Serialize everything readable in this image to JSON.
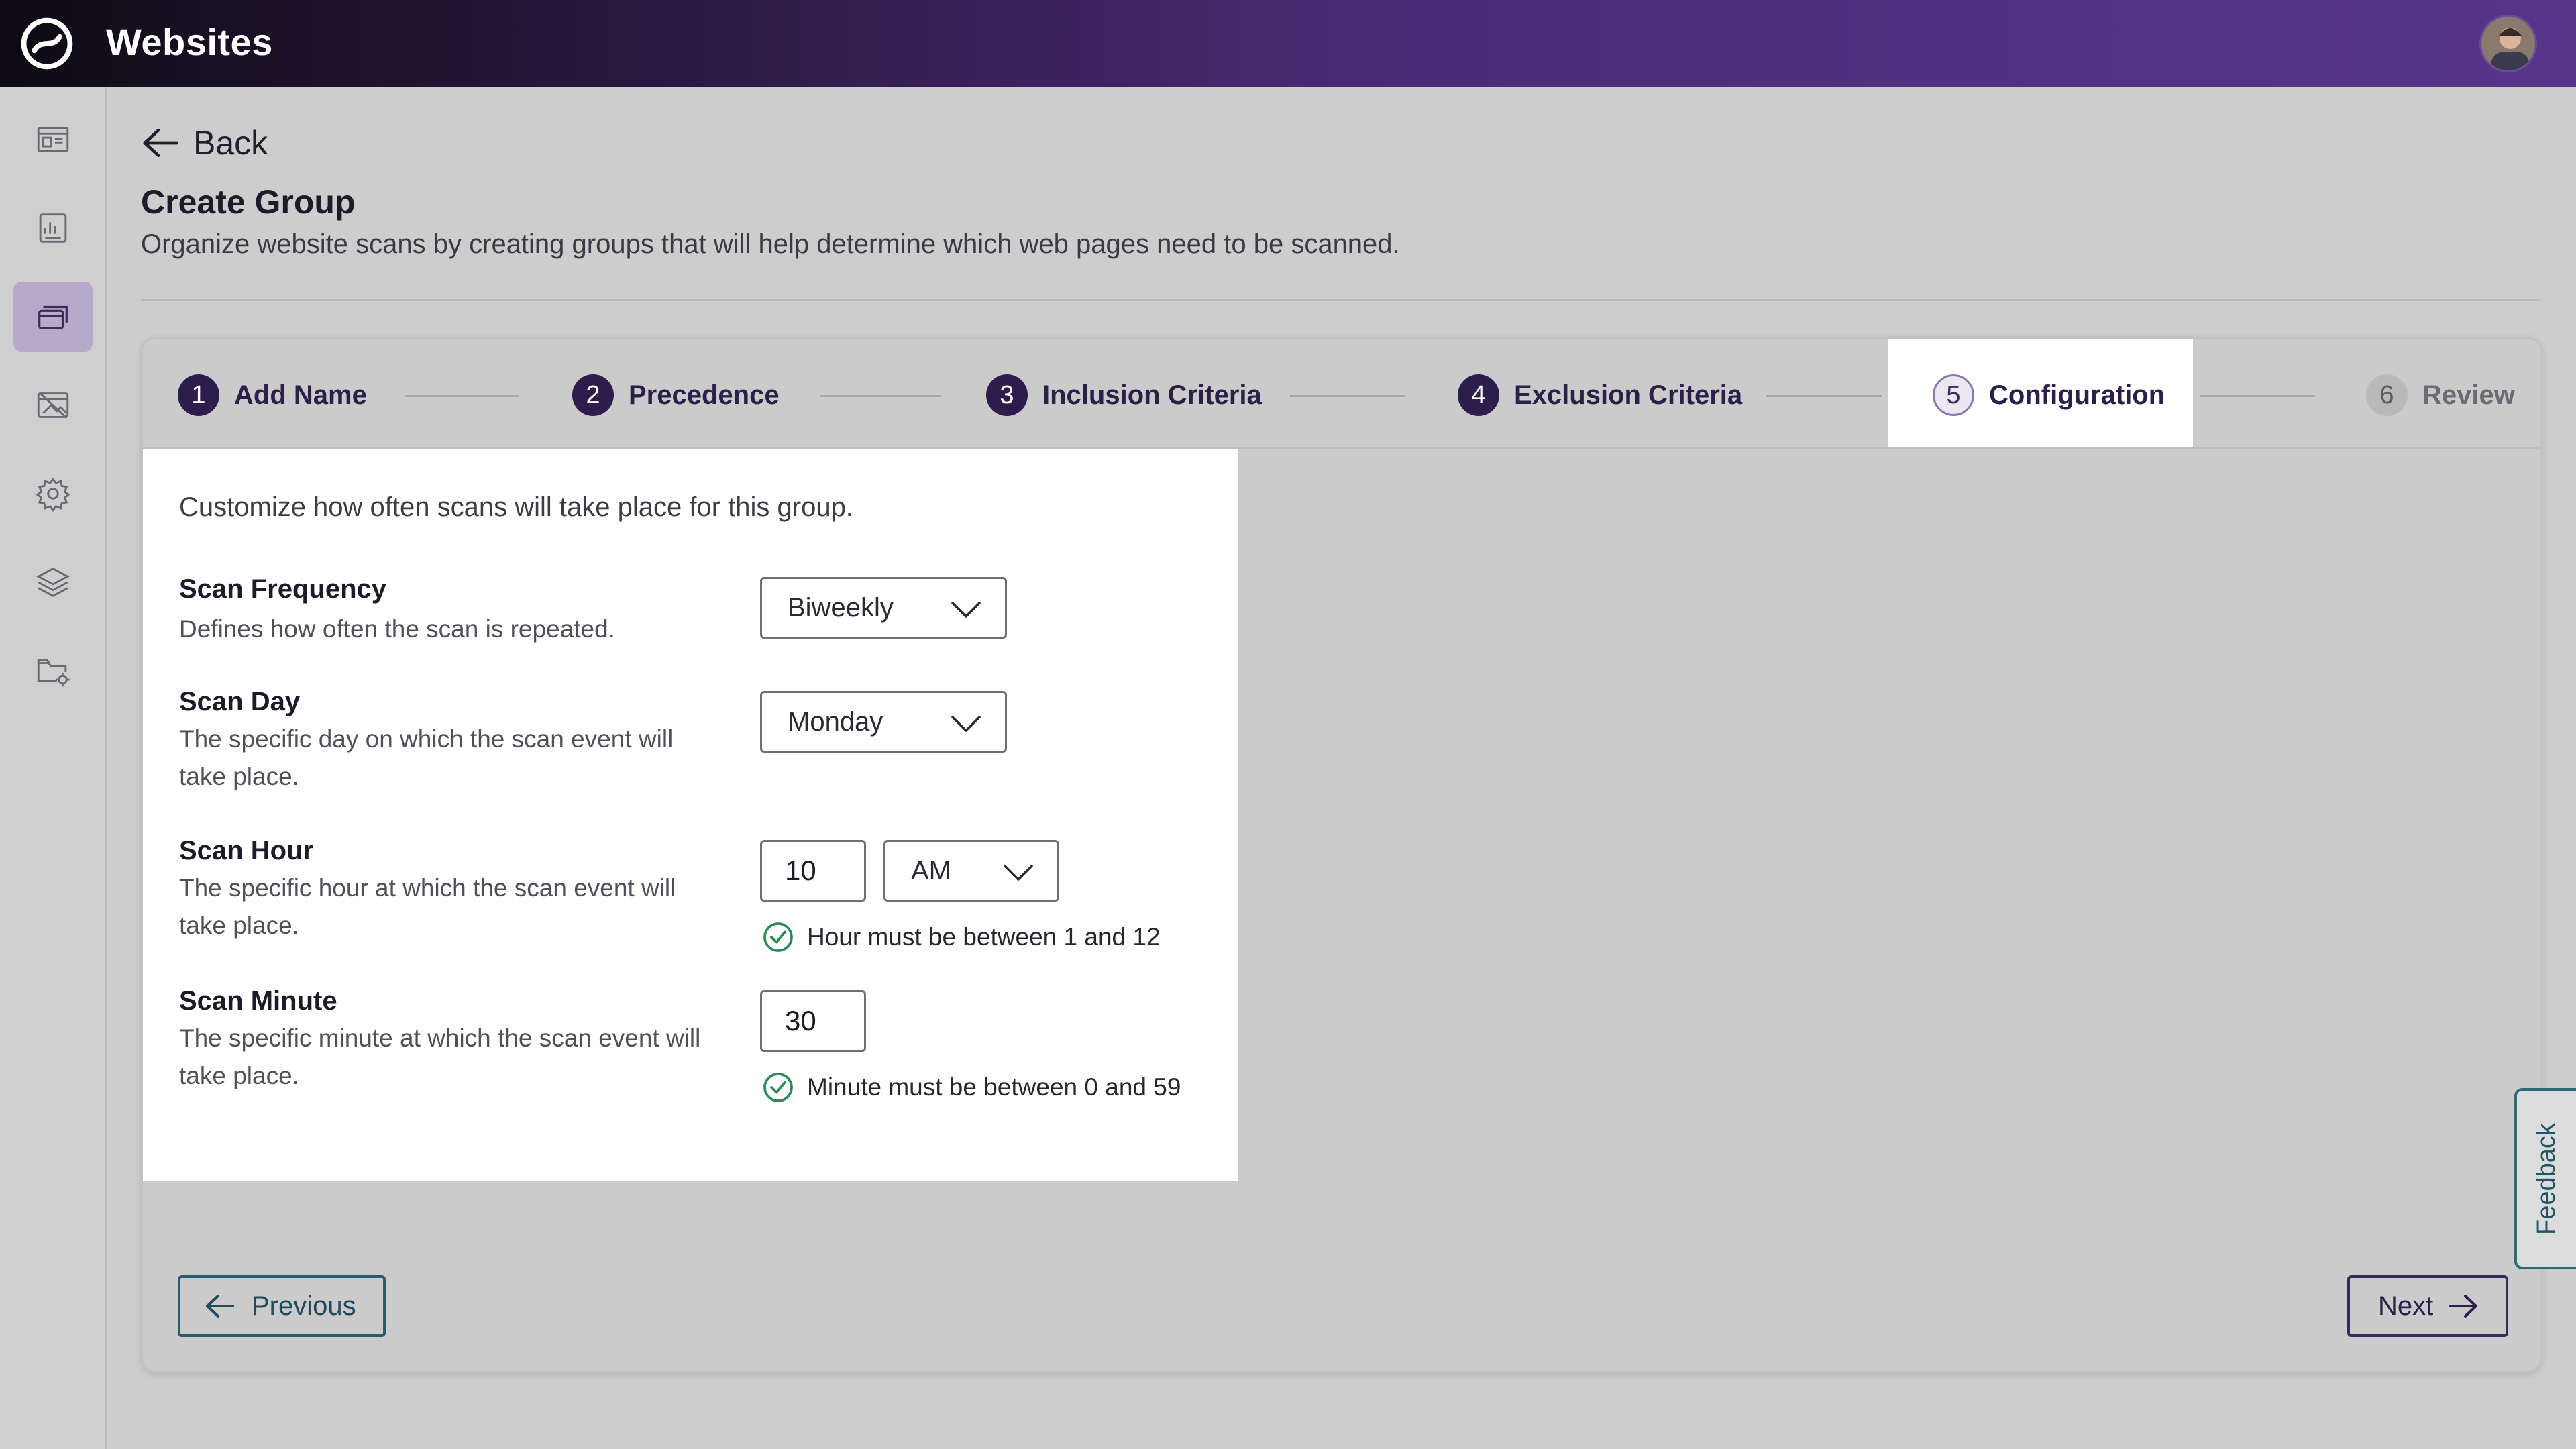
{
  "header": {
    "app_title": "Websites"
  },
  "sidebar": {
    "items": [
      {
        "icon": "dashboard-icon"
      },
      {
        "icon": "report-icon"
      },
      {
        "icon": "groups-icon",
        "active": true
      },
      {
        "icon": "image-off-icon"
      },
      {
        "icon": "gear-icon"
      },
      {
        "icon": "layers-icon"
      },
      {
        "icon": "folder-settings-icon"
      }
    ]
  },
  "page": {
    "back_label": "Back",
    "title": "Create Group",
    "subtitle": "Organize website scans by creating groups that will help determine which web pages need to be scanned."
  },
  "steps": [
    {
      "number": "1",
      "label": "Add Name",
      "state": "done"
    },
    {
      "number": "2",
      "label": "Precedence",
      "state": "done"
    },
    {
      "number": "3",
      "label": "Inclusion Criteria",
      "state": "done"
    },
    {
      "number": "4",
      "label": "Exclusion Criteria",
      "state": "done"
    },
    {
      "number": "5",
      "label": "Configuration",
      "state": "current"
    },
    {
      "number": "6",
      "label": "Review",
      "state": "future"
    }
  ],
  "form": {
    "intro": "Customize how often scans will take place for this group.",
    "frequency": {
      "label": "Scan Frequency",
      "help": "Defines how often the scan is repeated.",
      "value": "Biweekly"
    },
    "day": {
      "label": "Scan Day",
      "help": "The specific day on which the scan event will take place.",
      "value": "Monday"
    },
    "hour": {
      "label": "Scan Hour",
      "help": "The specific hour at which the scan event will take place.",
      "value": "10",
      "ampm": "AM",
      "hint": "Hour must be between 1 and 12"
    },
    "minute": {
      "label": "Scan Minute",
      "help": "The specific minute at which the scan event will take place.",
      "value": "30",
      "hint": "Minute must be between 0 and 59"
    }
  },
  "footer": {
    "previous_label": "Previous",
    "next_label": "Next"
  },
  "feedback_label": "Feedback",
  "colors": {
    "accent": "#2d1d4d",
    "teal": "#2a5b6d",
    "success": "#2e8b57"
  }
}
